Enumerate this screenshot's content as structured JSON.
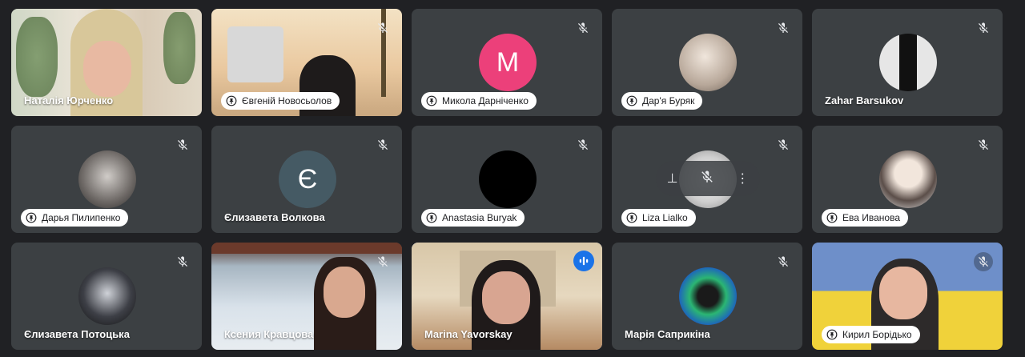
{
  "participants": [
    {
      "name": "Наталія Юрченко",
      "label_style": "plain"
    },
    {
      "name": "Євгеній Новосьолов",
      "label_style": "pill"
    },
    {
      "name": "Микола Дарніченко",
      "label_style": "pill",
      "avatar_letter": "M",
      "avatar_color": "#ec407a"
    },
    {
      "name": "Дар'я Буряк",
      "label_style": "pill"
    },
    {
      "name": "Zahar Barsukov",
      "label_style": "plain"
    },
    {
      "name": "Дарья Пилипенко",
      "label_style": "pill"
    },
    {
      "name": "Єлизавета Волкова",
      "label_style": "plain",
      "avatar_letter": "Є",
      "avatar_color": "#455a64"
    },
    {
      "name": "Anastasia Buryak",
      "label_style": "pill"
    },
    {
      "name": "Liza Lialko",
      "label_style": "pill"
    },
    {
      "name": "Ева Иванова",
      "label_style": "pill"
    },
    {
      "name": "Єлизавета Потоцька",
      "label_style": "plain"
    },
    {
      "name": "Ксения Кравцова",
      "label_style": "plain"
    },
    {
      "name": "Marina Yavorskay",
      "label_style": "plain",
      "speaking": true
    },
    {
      "name": "Марія Саприкіна",
      "label_style": "plain"
    },
    {
      "name": "Кирил Борідько",
      "label_style": "pill"
    }
  ],
  "colors": {
    "background": "#202124",
    "tile": "#3c4043",
    "speaking_accent": "#8ab4f8",
    "speaking_badge": "#1a73e8"
  },
  "icons": {
    "mic_off": "mic-off-icon",
    "pin": "pin-icon",
    "speaking": "audio-level-icon",
    "more": "more-vert-icon"
  }
}
